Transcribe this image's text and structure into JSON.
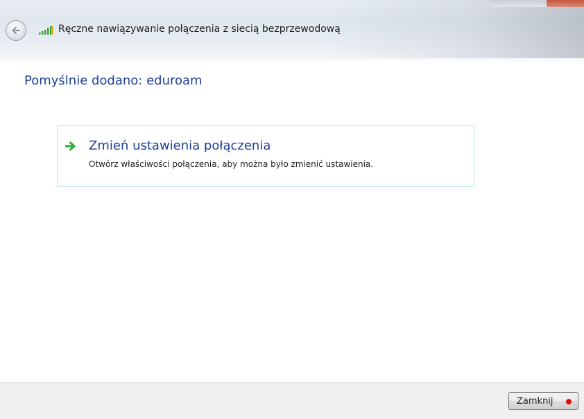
{
  "window": {
    "title": "Ręczne nawiązywanie połączenia z siecią bezprzewodową"
  },
  "main": {
    "heading": "Pomyślnie dodano: eduroam",
    "link": {
      "title": "Zmień ustawienia połączenia",
      "description": "Otwórz właściwości połączenia, aby można było zmienić ustawienia."
    }
  },
  "footer": {
    "close_label": "Zamknij"
  },
  "icons": {
    "back": "back-arrow-icon",
    "network": "wireless-signal-icon",
    "link": "green-arrow-icon",
    "marker": "red-dot-icon"
  },
  "colors": {
    "heading": "#1e3f9a",
    "link_border": "#bfe6ee",
    "arrow": "#2fae3a",
    "footer_bg": "#f0f0f0",
    "marker": "#e00d0d"
  }
}
